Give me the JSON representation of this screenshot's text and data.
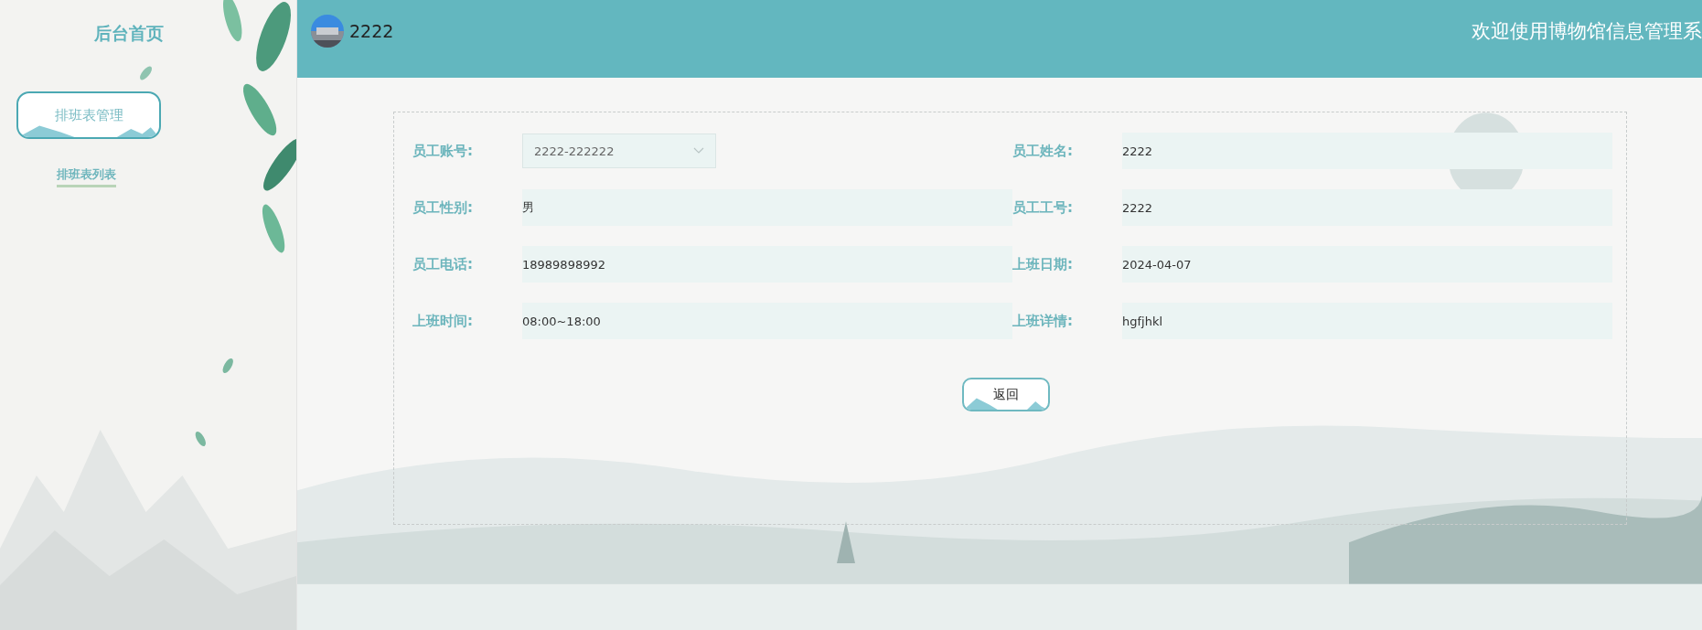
{
  "sidebar": {
    "title": "后台首页",
    "menu": [
      {
        "label": "排班表管理",
        "expanded": true,
        "children": [
          {
            "label": "排班表列表",
            "selected": true
          }
        ]
      }
    ]
  },
  "header": {
    "user": "2222",
    "welcome": "欢迎使用博物馆信息管理系"
  },
  "form": {
    "fields": [
      {
        "label": "员工账号:",
        "value": "2222-222222",
        "kind": "select"
      },
      {
        "label": "员工姓名:",
        "value": "2222",
        "kind": "text"
      },
      {
        "label": "员工性别:",
        "value": "男",
        "kind": "text"
      },
      {
        "label": "员工工号:",
        "value": "2222",
        "kind": "text"
      },
      {
        "label": "员工电话:",
        "value": "18989898992",
        "kind": "text"
      },
      {
        "label": "上班日期:",
        "value": "2024-04-07",
        "kind": "text"
      },
      {
        "label": "上班时间:",
        "value": "08:00~18:00",
        "kind": "text"
      },
      {
        "label": "上班详情:",
        "value": "hgfjhkl",
        "kind": "text"
      }
    ],
    "button": "返回"
  }
}
